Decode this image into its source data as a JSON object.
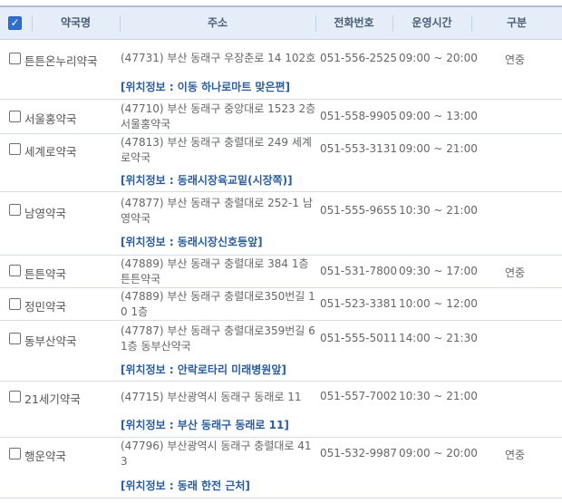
{
  "header": {
    "columns": [
      "약국명",
      "주소",
      "전화번호",
      "운영시간",
      "구분"
    ]
  },
  "rows": [
    {
      "name": "튼튼온누리약국",
      "address": "(47731) 부산 동래구 우장춘로 14 102호",
      "phone": "051-556-2525",
      "hours": "09:00 ~ 20:00",
      "type": "연중",
      "location": "[위치정보 : 이동 하나로마트 맞은편]"
    },
    {
      "name": "서울홍약국",
      "address": "(47710) 부산 동래구 중앙대로 1523 2층 서울홍약국",
      "phone": "051-558-9905",
      "hours": "09:00 ~ 13:00",
      "type": "",
      "location": ""
    },
    {
      "name": "세계로약국",
      "address": "(47813) 부산 동래구 충렬대로 249 세계로약국",
      "phone": "051-553-3131",
      "hours": "09:00 ~ 21:00",
      "type": "",
      "location": "[위치정보 : 동래시장육교밑(시장쪽)]"
    },
    {
      "name": "남영약국",
      "address": "(47877) 부산 동래구 충렬대로 252-1 남영약국",
      "phone": "051-555-9655",
      "hours": "10:30 ~ 21:00",
      "type": "",
      "location": "[위치정보 : 동래시장신호등앞]"
    },
    {
      "name": "튼튼약국",
      "address": "(47889) 부산 동래구 충렬대로 384 1층 튼튼약국",
      "phone": "051-531-7800",
      "hours": "09:30 ~ 17:00",
      "type": "연중",
      "location": ""
    },
    {
      "name": "정민약국",
      "address": "(47889) 부산 동래구 충렬대로350번길 10 1층",
      "phone": "051-523-3381",
      "hours": "10:00 ~ 12:00",
      "type": "",
      "location": ""
    },
    {
      "name": "동부산약국",
      "address": "(47787) 부산 동래구 충렬대로359번길 6 1층 동부산약국",
      "phone": "051-555-5011",
      "hours": "14:00 ~ 21:30",
      "type": "",
      "location": "[위치정보 : 안락로타리 미래병원앞]"
    },
    {
      "name": "21세기약국",
      "address": "(47715) 부산광역시 동래구 동래로 11",
      "phone": "051-557-7002",
      "hours": "10:30 ~ 21:00",
      "type": "",
      "location": "[위치정보 : 부산 동래구 동래로 11]"
    },
    {
      "name": "행운약국",
      "address": "(47796) 부산광역시 동래구 충렬대로 413",
      "phone": "051-532-9987",
      "hours": "09:00 ~ 20:00",
      "type": "연중",
      "location": "[위치정보 : 동래 한전 근처]"
    }
  ]
}
